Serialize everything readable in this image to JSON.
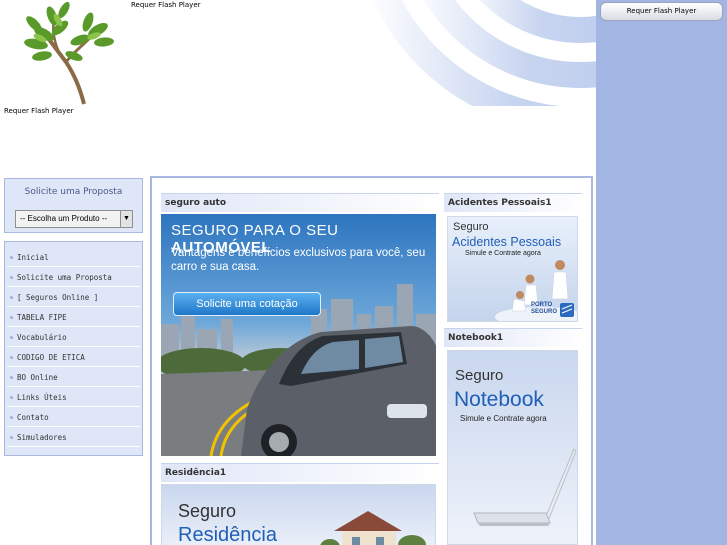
{
  "header": {
    "flash_notice_top": "Requer Flash Player",
    "flash_notice_left": "Requer Flash Player"
  },
  "right_column": {
    "flash_button": "Requer Flash Player"
  },
  "sidebar": {
    "proposta_title": "Solicite uma Proposta",
    "product_select_value": "-- Escolha um Produto --",
    "menu_items": [
      {
        "label": "Inicial"
      },
      {
        "label": "Solicite uma Proposta"
      },
      {
        "label": "[ Seguros Online ]"
      },
      {
        "label": "TABELA FIPE"
      },
      {
        "label": "Vocabulário"
      },
      {
        "label": "CODIGO DE ETICA"
      },
      {
        "label": "BO Online"
      },
      {
        "label": "Links Úteis"
      },
      {
        "label": "Contato"
      },
      {
        "label": "Simuladores"
      }
    ]
  },
  "panels": {
    "auto": {
      "title": "seguro auto",
      "banner_head_light": "SEGURO",
      "banner_head_mid": " PARA O SEU ",
      "banner_head_bold": "AUTOMÓVEL",
      "banner_sub": "Vantagens e benefícios exclusivos para você, seu carro e sua casa.",
      "banner_button": "Solicite uma cotação"
    },
    "acidentes": {
      "title": "Acidentes Pessoais1",
      "line1": "Seguro",
      "line2": "Acidentes Pessoais",
      "line3": "Simule e Contrate agora",
      "logo": "PORTO SEGURO"
    },
    "notebook": {
      "title": "Notebook1",
      "line1": "Seguro",
      "line2": "Notebook",
      "line3": "Simule e Contrate agora"
    },
    "residencia": {
      "title": "Residência1",
      "line1": "Seguro",
      "line2": "Residência"
    }
  },
  "colors": {
    "right_column": "#a3b6e3",
    "panel_border": "#a8b8e0",
    "accent_blue": "#1f5fb6"
  }
}
